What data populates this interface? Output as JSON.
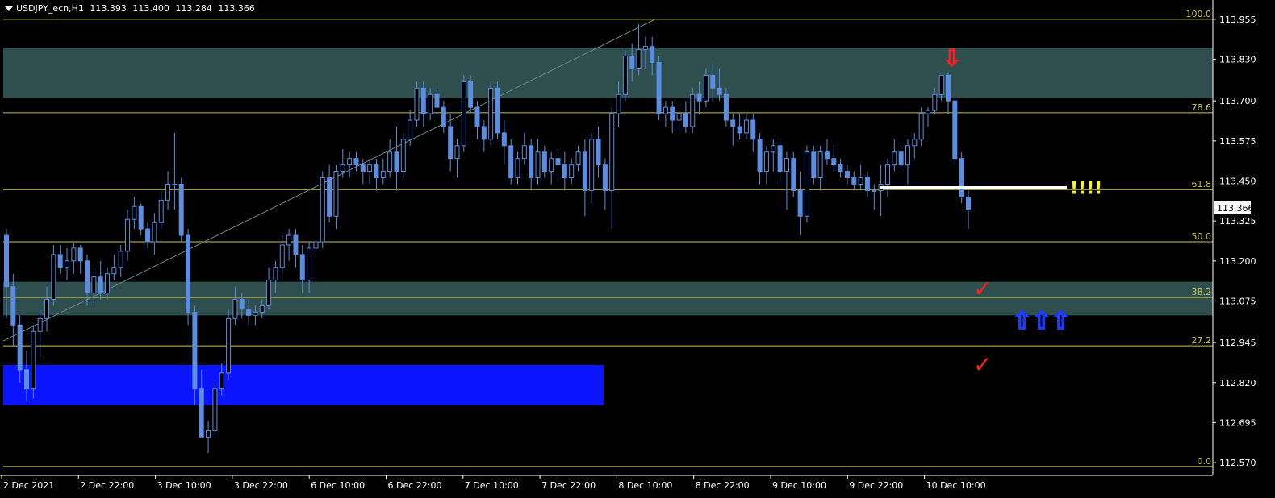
{
  "header": {
    "symbol": "USDJPY_ecn,H1",
    "open": "113.393",
    "high": "113.400",
    "low": "113.284",
    "close": "113.366"
  },
  "colors": {
    "background": "#000000",
    "candle": "#5b8de0",
    "grid_line": "#c8c34a",
    "zone": "#2f4f4f",
    "support_box": "#0a14ff",
    "price_tag_bg": "#ffffff",
    "annotation_red": "#ff2020",
    "annotation_blue": "#1a3cff",
    "annotation_yellow": "#ffff00"
  },
  "chart_data": {
    "type": "candlestick",
    "timeframe": "H1",
    "y_ticks": [
      "113.955",
      "113.830",
      "113.700",
      "113.575",
      "113.450",
      "113.325",
      "113.200",
      "113.075",
      "112.945",
      "112.820",
      "112.695",
      "112.570"
    ],
    "ylim": [
      112.53,
      114.0
    ],
    "x_ticks": [
      "2 Dec 2021",
      "2 Dec 22:00",
      "3 Dec 10:00",
      "3 Dec 22:00",
      "6 Dec 10:00",
      "6 Dec 22:00",
      "7 Dec 10:00",
      "7 Dec 22:00",
      "8 Dec 10:00",
      "8 Dec 22:00",
      "9 Dec 10:00",
      "9 Dec 22:00",
      "10 Dec 10:00"
    ],
    "current_price": "113.366",
    "fibonacci": [
      {
        "label": "100.0",
        "price": 113.955
      },
      {
        "label": "78.6",
        "price": 113.663
      },
      {
        "label": "61.8",
        "price": 113.423
      },
      {
        "label": "50.0",
        "price": 113.26
      },
      {
        "label": "38.2",
        "price": 113.086
      },
      {
        "label": "27.2",
        "price": 112.935
      },
      {
        "label": "0.0",
        "price": 112.558
      }
    ],
    "zones": [
      {
        "from": 113.71,
        "to": 113.865,
        "color": "#2f4f4f"
      },
      {
        "from": 113.03,
        "to": 113.135,
        "color": "#2f4f4f"
      }
    ],
    "support_box": {
      "from": 112.75,
      "to": 112.875
    },
    "annotations": {
      "alert_text": "!!!!",
      "marker_level": 113.43,
      "down_arrow": "⇩",
      "up_arrows": [
        "⇧",
        "⇧",
        "⇧"
      ],
      "check_marks": [
        "✓",
        "✓"
      ]
    },
    "candles": [
      [
        113.28,
        113.3,
        113.02,
        113.12
      ],
      [
        113.12,
        113.16,
        112.93,
        113.0
      ],
      [
        113.0,
        113.03,
        112.82,
        112.86
      ],
      [
        112.86,
        112.92,
        112.76,
        112.8
      ],
      [
        112.8,
        113.0,
        112.77,
        112.98
      ],
      [
        112.98,
        113.05,
        112.9,
        113.02
      ],
      [
        113.02,
        113.12,
        112.98,
        113.08
      ],
      [
        113.08,
        113.25,
        113.06,
        113.22
      ],
      [
        113.22,
        113.25,
        113.16,
        113.18
      ],
      [
        113.18,
        113.24,
        113.14,
        113.2
      ],
      [
        113.2,
        113.26,
        113.16,
        113.24
      ],
      [
        113.24,
        113.25,
        113.16,
        113.2
      ],
      [
        113.2,
        113.22,
        113.06,
        113.1
      ],
      [
        113.1,
        113.18,
        113.06,
        113.15
      ],
      [
        113.15,
        113.2,
        113.08,
        113.1
      ],
      [
        113.1,
        113.18,
        113.08,
        113.16
      ],
      [
        113.16,
        113.22,
        113.14,
        113.18
      ],
      [
        113.18,
        113.25,
        113.15,
        113.23
      ],
      [
        113.23,
        113.36,
        113.2,
        113.33
      ],
      [
        113.33,
        113.4,
        113.3,
        113.37
      ],
      [
        113.37,
        113.38,
        113.28,
        113.3
      ],
      [
        113.3,
        113.32,
        113.24,
        113.26
      ],
      [
        113.26,
        113.35,
        113.22,
        113.32
      ],
      [
        113.32,
        113.42,
        113.3,
        113.39
      ],
      [
        113.39,
        113.48,
        113.36,
        113.44
      ],
      [
        113.44,
        113.6,
        113.36,
        113.44
      ],
      [
        113.44,
        113.46,
        113.26,
        113.28
      ],
      [
        113.28,
        113.3,
        113.0,
        113.04
      ],
      [
        113.04,
        113.06,
        112.75,
        112.8
      ],
      [
        112.8,
        112.86,
        112.65,
        112.65
      ],
      [
        112.65,
        112.7,
        112.6,
        112.67
      ],
      [
        112.67,
        112.82,
        112.65,
        112.8
      ],
      [
        112.8,
        112.88,
        112.78,
        112.85
      ],
      [
        112.85,
        113.05,
        112.83,
        113.02
      ],
      [
        113.02,
        113.12,
        113.0,
        113.08
      ],
      [
        113.08,
        113.1,
        113.02,
        113.05
      ],
      [
        113.05,
        113.08,
        113.0,
        113.03
      ],
      [
        113.03,
        113.06,
        113.0,
        113.04
      ],
      [
        113.04,
        113.08,
        113.02,
        113.06
      ],
      [
        113.06,
        113.18,
        113.05,
        113.14
      ],
      [
        113.14,
        113.2,
        113.1,
        113.18
      ],
      [
        113.18,
        113.28,
        113.16,
        113.25
      ],
      [
        113.25,
        113.3,
        113.2,
        113.28
      ],
      [
        113.28,
        113.3,
        113.18,
        113.22
      ],
      [
        113.22,
        113.25,
        113.1,
        113.14
      ],
      [
        113.14,
        113.26,
        113.1,
        113.24
      ],
      [
        113.24,
        113.27,
        113.22,
        113.26
      ],
      [
        113.26,
        113.48,
        113.24,
        113.46
      ],
      [
        113.46,
        113.5,
        113.32,
        113.34
      ],
      [
        113.34,
        113.5,
        113.3,
        113.48
      ],
      [
        113.48,
        113.55,
        113.46,
        113.5
      ],
      [
        113.5,
        113.54,
        113.46,
        113.52
      ],
      [
        113.52,
        113.54,
        113.48,
        113.5
      ],
      [
        113.5,
        113.52,
        113.44,
        113.48
      ],
      [
        113.48,
        113.52,
        113.44,
        113.5
      ],
      [
        113.5,
        113.52,
        113.42,
        113.46
      ],
      [
        113.46,
        113.52,
        113.44,
        113.48
      ],
      [
        113.48,
        113.58,
        113.46,
        113.54
      ],
      [
        113.54,
        113.62,
        113.42,
        113.48
      ],
      [
        113.48,
        113.6,
        113.46,
        113.58
      ],
      [
        113.58,
        113.67,
        113.56,
        113.64
      ],
      [
        113.64,
        113.76,
        113.62,
        113.74
      ],
      [
        113.74,
        113.76,
        113.62,
        113.66
      ],
      [
        113.66,
        113.74,
        113.64,
        113.72
      ],
      [
        113.72,
        113.74,
        113.64,
        113.68
      ],
      [
        113.68,
        113.7,
        113.6,
        113.62
      ],
      [
        113.62,
        113.66,
        113.48,
        113.52
      ],
      [
        113.52,
        113.58,
        113.46,
        113.56
      ],
      [
        113.56,
        113.78,
        113.54,
        113.76
      ],
      [
        113.76,
        113.78,
        113.66,
        113.68
      ],
      [
        113.68,
        113.7,
        113.58,
        113.62
      ],
      [
        113.62,
        113.64,
        113.54,
        113.58
      ],
      [
        113.58,
        113.76,
        113.56,
        113.74
      ],
      [
        113.74,
        113.76,
        113.58,
        113.6
      ],
      [
        113.6,
        113.64,
        113.5,
        113.56
      ],
      [
        113.56,
        113.58,
        113.44,
        113.46
      ],
      [
        113.46,
        113.54,
        113.44,
        113.52
      ],
      [
        113.52,
        113.6,
        113.5,
        113.56
      ],
      [
        113.56,
        113.58,
        113.42,
        113.46
      ],
      [
        113.46,
        113.58,
        113.44,
        113.54
      ],
      [
        113.54,
        113.56,
        113.46,
        113.48
      ],
      [
        113.48,
        113.54,
        113.44,
        113.52
      ],
      [
        113.52,
        113.55,
        113.46,
        113.5
      ],
      [
        113.5,
        113.54,
        113.42,
        113.46
      ],
      [
        113.46,
        113.52,
        113.44,
        113.5
      ],
      [
        113.5,
        113.56,
        113.48,
        113.54
      ],
      [
        113.54,
        113.58,
        113.34,
        113.42
      ],
      [
        113.42,
        113.6,
        113.38,
        113.58
      ],
      [
        113.58,
        113.62,
        113.46,
        113.5
      ],
      [
        113.5,
        113.52,
        113.36,
        113.42
      ],
      [
        113.42,
        113.68,
        113.3,
        113.66
      ],
      [
        113.66,
        113.76,
        113.62,
        113.72
      ],
      [
        113.72,
        113.86,
        113.7,
        113.84
      ],
      [
        113.84,
        113.88,
        113.76,
        113.8
      ],
      [
        113.8,
        113.94,
        113.78,
        113.86
      ],
      [
        113.86,
        113.9,
        113.8,
        113.87
      ],
      [
        113.87,
        113.9,
        113.78,
        113.82
      ],
      [
        113.82,
        113.84,
        113.64,
        113.66
      ],
      [
        113.66,
        113.7,
        113.62,
        113.68
      ],
      [
        113.68,
        113.7,
        113.6,
        113.64
      ],
      [
        113.64,
        113.68,
        113.6,
        113.66
      ],
      [
        113.66,
        113.7,
        113.6,
        113.62
      ],
      [
        113.62,
        113.74,
        113.6,
        113.72
      ],
      [
        113.72,
        113.76,
        113.66,
        113.7
      ],
      [
        113.7,
        113.8,
        113.68,
        113.78
      ],
      [
        113.78,
        113.82,
        113.7,
        113.74
      ],
      [
        113.74,
        113.8,
        113.7,
        113.72
      ],
      [
        113.72,
        113.74,
        113.62,
        113.64
      ],
      [
        113.64,
        113.66,
        113.56,
        113.62
      ],
      [
        113.62,
        113.66,
        113.58,
        113.6
      ],
      [
        113.6,
        113.66,
        113.58,
        113.64
      ],
      [
        113.64,
        113.66,
        113.54,
        113.58
      ],
      [
        113.58,
        113.6,
        113.44,
        113.48
      ],
      [
        113.48,
        113.56,
        113.44,
        113.54
      ],
      [
        113.54,
        113.58,
        113.48,
        113.56
      ],
      [
        113.56,
        113.58,
        113.44,
        113.48
      ],
      [
        113.48,
        113.54,
        113.36,
        113.52
      ],
      [
        113.52,
        113.54,
        113.4,
        113.42
      ],
      [
        113.42,
        113.48,
        113.28,
        113.34
      ],
      [
        113.34,
        113.56,
        113.32,
        113.54
      ],
      [
        113.54,
        113.56,
        113.44,
        113.46
      ],
      [
        113.46,
        113.56,
        113.42,
        113.54
      ],
      [
        113.54,
        113.58,
        113.5,
        113.52
      ],
      [
        113.52,
        113.56,
        113.48,
        113.5
      ],
      [
        113.5,
        113.52,
        113.46,
        113.48
      ],
      [
        113.48,
        113.5,
        113.44,
        113.46
      ],
      [
        113.46,
        113.48,
        113.42,
        113.44
      ],
      [
        113.44,
        113.5,
        113.42,
        113.46
      ],
      [
        113.46,
        113.48,
        113.4,
        113.42
      ],
      [
        113.42,
        113.44,
        113.36,
        113.42
      ],
      [
        113.42,
        113.5,
        113.34,
        113.44
      ],
      [
        113.44,
        113.52,
        113.4,
        113.5
      ],
      [
        113.5,
        113.58,
        113.48,
        113.54
      ],
      [
        113.54,
        113.56,
        113.48,
        113.5
      ],
      [
        113.5,
        113.58,
        113.44,
        113.56
      ],
      [
        113.56,
        113.6,
        113.52,
        113.58
      ],
      [
        113.58,
        113.68,
        113.56,
        113.66
      ],
      [
        113.66,
        113.68,
        113.62,
        113.67
      ],
      [
        113.67,
        113.74,
        113.66,
        113.72
      ],
      [
        113.72,
        113.78,
        113.7,
        113.78
      ],
      [
        113.78,
        113.79,
        113.66,
        113.7
      ],
      [
        113.7,
        113.72,
        113.5,
        113.52
      ],
      [
        113.52,
        113.54,
        113.38,
        113.4
      ],
      [
        113.4,
        113.42,
        113.3,
        113.36
      ]
    ]
  }
}
